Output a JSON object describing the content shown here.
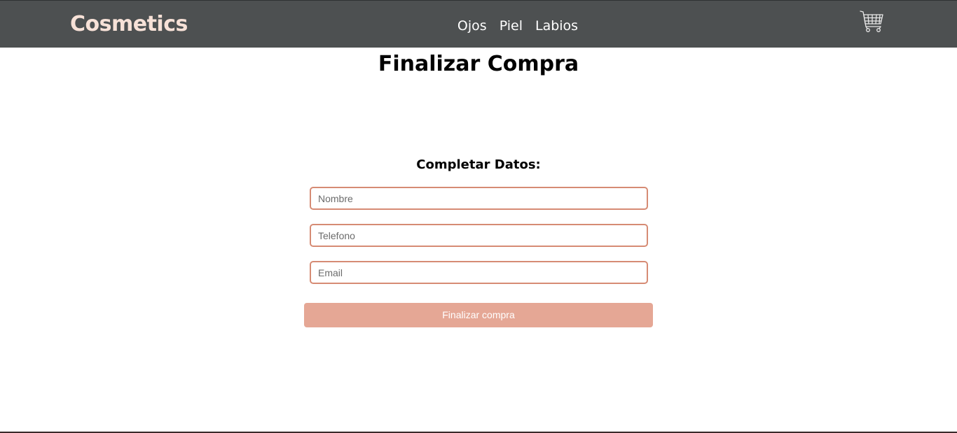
{
  "header": {
    "brand": "Cosmetics",
    "nav": [
      {
        "label": "Ojos"
      },
      {
        "label": "Piel"
      },
      {
        "label": "Labios"
      }
    ],
    "cart_icon": "shopping-cart-icon"
  },
  "page": {
    "title": "Finalizar Compra"
  },
  "form": {
    "heading": "Completar Datos:",
    "fields": [
      {
        "placeholder": "Nombre",
        "value": ""
      },
      {
        "placeholder": "Telefono",
        "value": ""
      },
      {
        "placeholder": "Email",
        "value": ""
      }
    ],
    "submit_label": "Finalizar compra"
  },
  "colors": {
    "navbar": "#4d5051",
    "brand": "#f7e1d7",
    "field_border": "#d68b74",
    "button": "#e5a795"
  }
}
